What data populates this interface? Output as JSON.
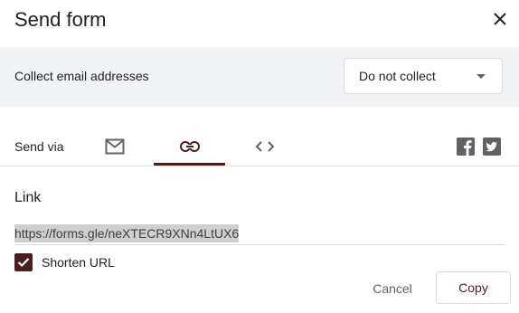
{
  "dialog": {
    "title": "Send form",
    "close_icon": "close-icon"
  },
  "collect": {
    "label": "Collect email addresses",
    "selected": "Do not collect"
  },
  "send_via": {
    "label": "Send via",
    "tabs": [
      {
        "name": "email",
        "icon": "mail-icon",
        "selected": false
      },
      {
        "name": "link",
        "icon": "link-icon",
        "selected": true
      },
      {
        "name": "embed",
        "icon": "code-icon",
        "selected": false
      }
    ],
    "social": [
      "facebook-icon",
      "twitter-icon"
    ]
  },
  "link": {
    "heading": "Link",
    "url": "https://forms.gle/neXTECR9XNn4LtUX6",
    "shorten_label": "Shorten URL",
    "shorten_checked": true
  },
  "actions": {
    "cancel": "Cancel",
    "copy": "Copy"
  },
  "colors": {
    "accent": "#4a1f1f",
    "band": "#f1f3f4",
    "divider": "#e0e0e0"
  }
}
